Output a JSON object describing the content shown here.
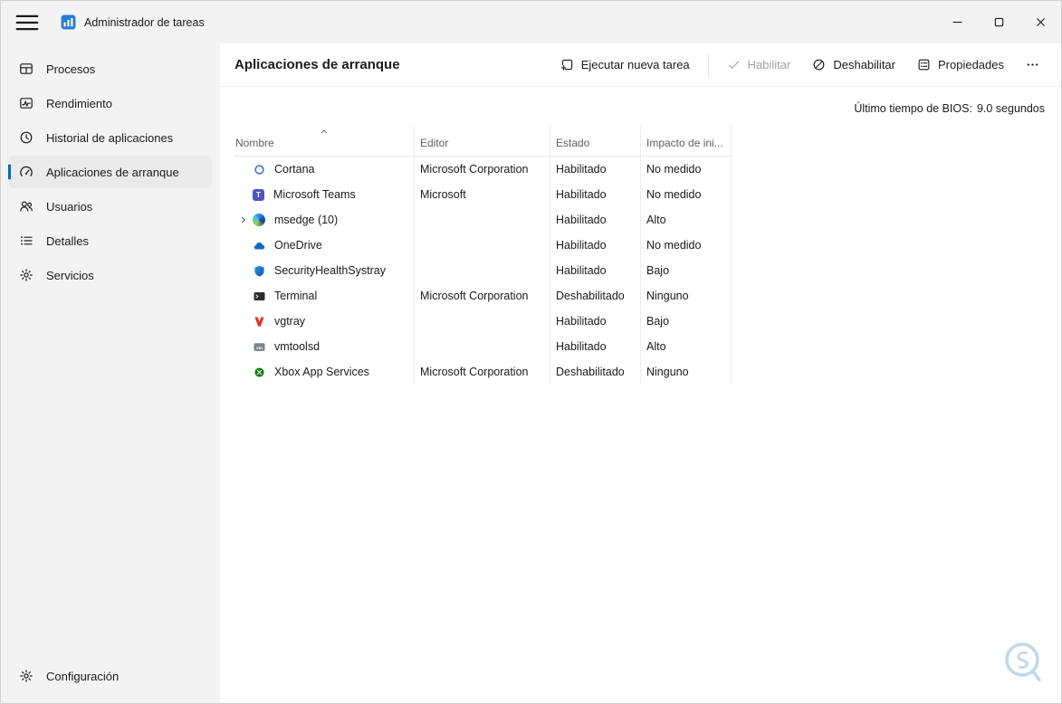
{
  "window": {
    "title": "Administrador de tareas",
    "controls": {
      "minimize_icon": "minimize-icon",
      "maximize_icon": "maximize-icon",
      "close_icon": "close-icon"
    }
  },
  "sidebar": {
    "items": [
      {
        "key": "procesos",
        "label": "Procesos",
        "icon": "processes",
        "selected": false
      },
      {
        "key": "rendimiento",
        "label": "Rendimiento",
        "icon": "performance",
        "selected": false
      },
      {
        "key": "historial-de-aplicaciones",
        "label": "Historial de aplicaciones",
        "icon": "history",
        "selected": false
      },
      {
        "key": "aplicaciones-de-arranque",
        "label": "Aplicaciones de arranque",
        "icon": "startup",
        "selected": true
      },
      {
        "key": "usuarios",
        "label": "Usuarios",
        "icon": "users",
        "selected": false
      },
      {
        "key": "detalles",
        "label": "Detalles",
        "icon": "details",
        "selected": false
      },
      {
        "key": "servicios",
        "label": "Servicios",
        "icon": "services",
        "selected": false
      }
    ],
    "footer": {
      "key": "configuracion",
      "label": "Configuración",
      "icon": "settings"
    }
  },
  "header": {
    "title": "Aplicaciones de arranque"
  },
  "toolbar": {
    "buttons": [
      {
        "key": "run-new-task",
        "label": "Ejecutar nueva tarea",
        "icon": "new-task",
        "enabled": true
      },
      {
        "key": "enable",
        "label": "Habilitar",
        "icon": "check",
        "enabled": false
      },
      {
        "key": "disable",
        "label": "Deshabilitar",
        "icon": "prohibited",
        "enabled": true
      },
      {
        "key": "properties",
        "label": "Propiedades",
        "icon": "properties",
        "enabled": true
      },
      {
        "key": "more",
        "label": "",
        "icon": "more",
        "enabled": true
      }
    ]
  },
  "bios": {
    "label": "Último tiempo de BIOS:",
    "value": "9.0 segundos"
  },
  "table": {
    "columns": [
      {
        "key": "nombre",
        "label": "Nombre",
        "sorted": "asc"
      },
      {
        "key": "editor",
        "label": "Editor",
        "sorted": ""
      },
      {
        "key": "estado",
        "label": "Estado",
        "sorted": ""
      },
      {
        "key": "impacto",
        "label": "Impacto de ini...",
        "sorted": ""
      }
    ],
    "rows": [
      {
        "name": "Cortana",
        "icon": "cortana",
        "editor": "Microsoft Corporation",
        "status": "Habilitado",
        "impact": "No medido",
        "expandable": false
      },
      {
        "name": "Microsoft Teams",
        "icon": "teams",
        "editor": "Microsoft",
        "status": "Habilitado",
        "impact": "No medido",
        "expandable": false
      },
      {
        "name": "msedge (10)",
        "icon": "edge",
        "editor": "",
        "status": "Habilitado",
        "impact": "Alto",
        "expandable": true
      },
      {
        "name": "OneDrive",
        "icon": "onedrive",
        "editor": "",
        "status": "Habilitado",
        "impact": "No medido",
        "expandable": false
      },
      {
        "name": "SecurityHealthSystray",
        "icon": "shield",
        "editor": "",
        "status": "Habilitado",
        "impact": "Bajo",
        "expandable": false
      },
      {
        "name": "Terminal",
        "icon": "terminal",
        "editor": "Microsoft Corporation",
        "status": "Deshabilitado",
        "impact": "Ninguno",
        "expandable": false
      },
      {
        "name": "vgtray",
        "icon": "vgtray",
        "editor": "",
        "status": "Habilitado",
        "impact": "Bajo",
        "expandable": false
      },
      {
        "name": "vmtoolsd",
        "icon": "vmtoolsd",
        "editor": "",
        "status": "Habilitado",
        "impact": "Alto",
        "expandable": false
      },
      {
        "name": "Xbox App Services",
        "icon": "xbox",
        "editor": "Microsoft Corporation",
        "status": "Deshabilitado",
        "impact": "Ninguno",
        "expandable": false
      }
    ]
  }
}
